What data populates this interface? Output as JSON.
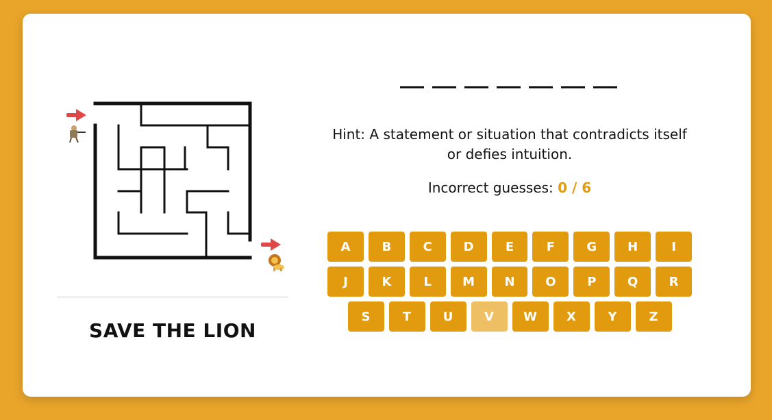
{
  "game": {
    "title": "SAVE THE LION",
    "word_length": 7,
    "hint_prefix": "Hint:",
    "hint_text": "A statement or situation that contradicts itself or defies intuition.",
    "guesses_label": "Incorrect guesses:",
    "incorrect_guesses": "0 / 6"
  },
  "maze": {
    "start_marker": "hunter-icon",
    "end_marker": "lion-icon",
    "arrow_color": "#E04848"
  },
  "keyboard": {
    "rows": [
      [
        "A",
        "B",
        "C",
        "D",
        "E",
        "F",
        "G",
        "H",
        "I"
      ],
      [
        "J",
        "K",
        "L",
        "M",
        "N",
        "O",
        "P",
        "Q",
        "R"
      ],
      [
        "S",
        "T",
        "U",
        "V",
        "W",
        "X",
        "Y",
        "Z"
      ]
    ],
    "used_letters": [
      "V"
    ]
  },
  "colors": {
    "background": "#E9A52A",
    "key": "#E29A0F",
    "key_used": "#EEC063",
    "accent": "#E09C16"
  }
}
